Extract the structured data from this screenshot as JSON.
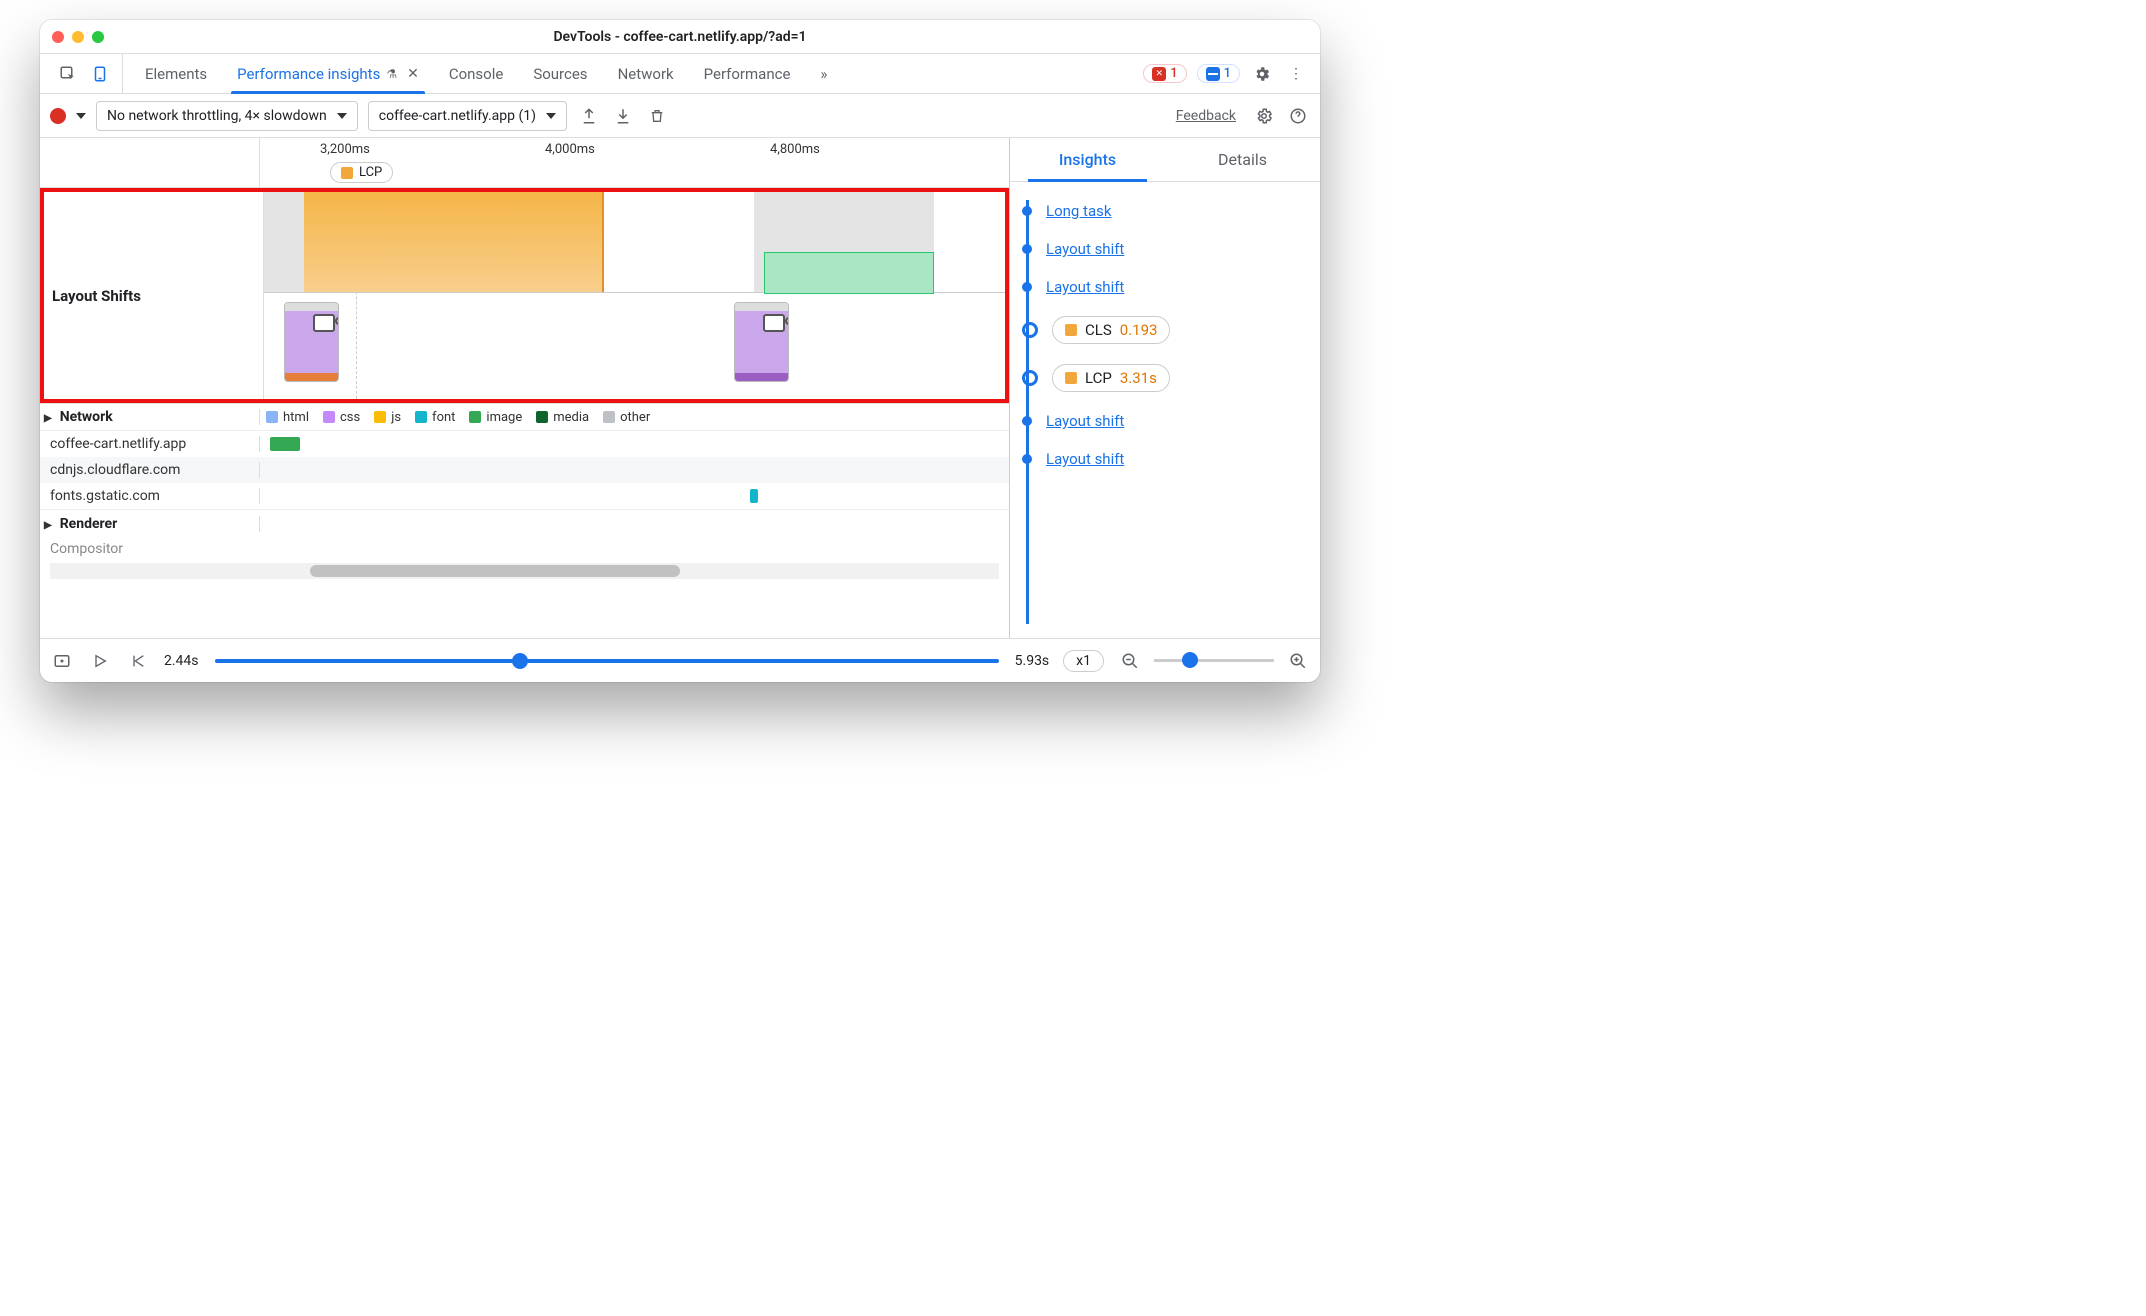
{
  "window": {
    "title": "DevTools - coffee-cart.netlify.app/?ad=1"
  },
  "badges": {
    "errors": "1",
    "messages": "1"
  },
  "tabs": {
    "elements": "Elements",
    "perf_insights": "Performance insights",
    "console": "Console",
    "sources": "Sources",
    "network": "Network",
    "performance": "Performance",
    "more": "»"
  },
  "toolbar": {
    "throttle": "No network throttling, 4× slowdown",
    "recording": "coffee-cart.netlify.app (1)",
    "feedback": "Feedback"
  },
  "timeline": {
    "ticks": [
      "3,200ms",
      "4,000ms",
      "4,800ms"
    ],
    "lcp_label": "LCP",
    "layout_shifts_label": "Layout Shifts"
  },
  "network": {
    "label": "Network",
    "legend": {
      "html": "html",
      "css": "css",
      "js": "js",
      "font": "font",
      "image": "image",
      "media": "media",
      "other": "other"
    },
    "rows": [
      "coffee-cart.netlify.app",
      "cdnjs.cloudflare.com",
      "fonts.gstatic.com"
    ],
    "renderer": "Renderer",
    "compositor": "Compositor"
  },
  "right": {
    "tab_insights": "Insights",
    "tab_details": "Details",
    "items": {
      "long_task": "Long task",
      "layout_shift": "Layout shift",
      "cls_label": "CLS",
      "cls_value": "0.193",
      "lcp_label": "LCP",
      "lcp_value": "3.31s"
    }
  },
  "footer": {
    "start": "2.44s",
    "end": "5.93s",
    "speed": "x1"
  }
}
